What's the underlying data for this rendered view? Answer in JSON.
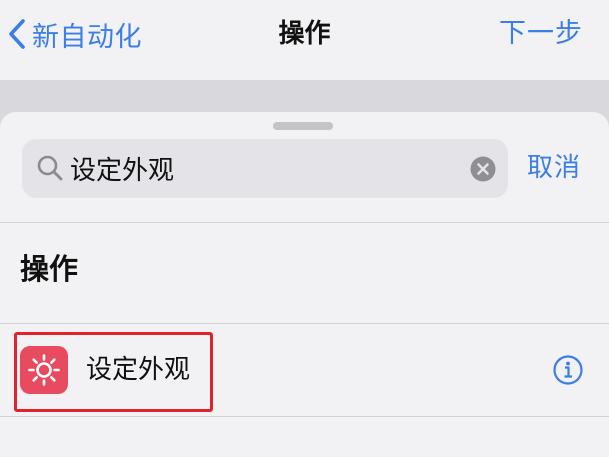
{
  "nav": {
    "back_label": "新自动化",
    "title": "操作",
    "next_label": "下一步"
  },
  "search": {
    "value": "设定外观",
    "cancel_label": "取消"
  },
  "section": {
    "title": "操作"
  },
  "results": [
    {
      "label": "设定外观",
      "icon": "sun-icon",
      "icon_color": "#e84a5f"
    }
  ],
  "colors": {
    "accent": "#3a7ee6",
    "highlight": "#e0232b"
  }
}
